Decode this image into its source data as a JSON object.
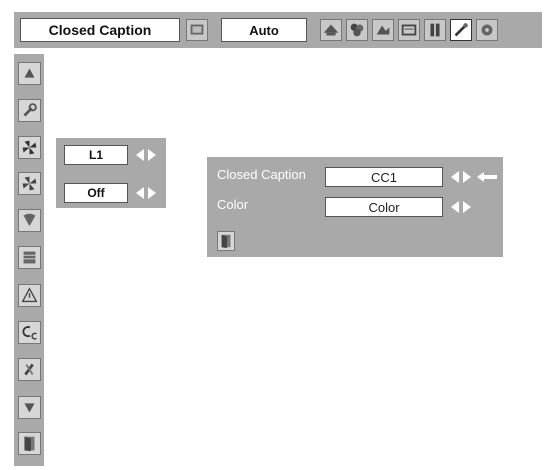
{
  "toolbar": {
    "title": "Closed Caption",
    "mode_value": "Auto",
    "icons": [
      "picture-adjust-icon",
      "screen-icon",
      "color-icon",
      "image-icon",
      "computer-icon",
      "input-icon",
      "setting-icon",
      "memory-icon"
    ]
  },
  "sidebar": {
    "icons": [
      "up-arrow-icon",
      "wrench-icon",
      "fan-icon",
      "fan-icon",
      "lamp-icon",
      "filter-icon",
      "warning-icon",
      "closed-caption-icon",
      "security-icon",
      "down-arrow-icon",
      "exit-icon"
    ]
  },
  "submenu": {
    "field1": "L1",
    "field2": "Off"
  },
  "panel": {
    "rows": [
      {
        "label": "Closed Caption",
        "value": "CC1"
      },
      {
        "label": "Color",
        "value": "Color"
      }
    ]
  },
  "colors": {
    "menu_bg": "#a9a9a9",
    "field_bg": "#ffffff",
    "label_text": "#ffffff"
  }
}
